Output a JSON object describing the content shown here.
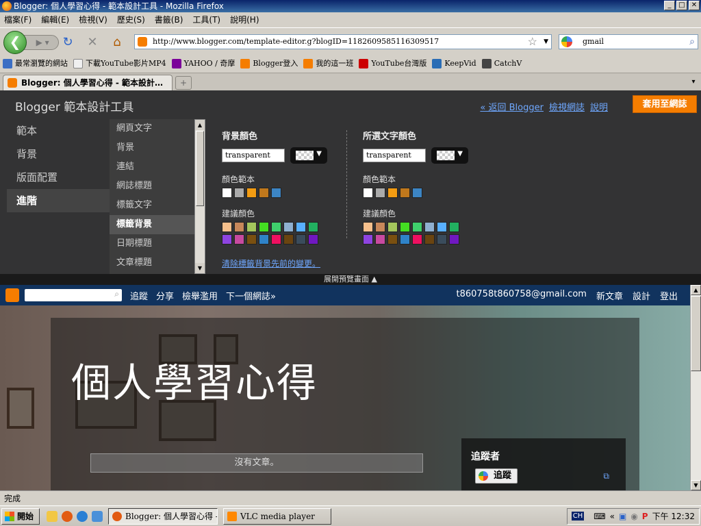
{
  "window": {
    "title": "Blogger: 個人學習心得 - 範本設計工具 - Mozilla Firefox"
  },
  "menu": [
    "檔案(F)",
    "編輯(E)",
    "檢視(V)",
    "歷史(S)",
    "書籤(B)",
    "工具(T)",
    "說明(H)"
  ],
  "address": {
    "url": "http://www.blogger.com/template-editor.g?blogID=1182609585116309517"
  },
  "search": {
    "value": "gmail"
  },
  "bookmarks": [
    {
      "label": "最常瀏覽的網站",
      "color": "#3c6fc4"
    },
    {
      "label": "下載YouTube影片MP4",
      "color": "#f0f0f0"
    },
    {
      "label": "YAHOO / 奇摩",
      "color": "#7b0099"
    },
    {
      "label": "Blogger登入",
      "color": "#f57d00"
    },
    {
      "label": "我的這一班",
      "color": "#f57d00"
    },
    {
      "label": "YouTube台灣版",
      "color": "#cc0000"
    },
    {
      "label": "KeepVid",
      "color": "#2a6db5"
    },
    {
      "label": "CatchV",
      "color": "#444444"
    }
  ],
  "tab": {
    "label": "Blogger: 個人學習心得 - 範本設計…"
  },
  "designer": {
    "title": "Blogger 範本設計工具",
    "links": [
      "« 返回 Blogger",
      "檢視網誌",
      "說明"
    ],
    "apply_label": "套用至網誌",
    "nav": [
      "範本",
      "背景",
      "版面配置",
      "進階"
    ],
    "subnav": [
      "網頁文字",
      "背景",
      "連結",
      "網誌標題",
      "標籤文字",
      "標籤背景",
      "日期標題",
      "文章標題"
    ],
    "bg_panel": {
      "title": "背景顏色",
      "value": "transparent",
      "scheme_label": "顏色範本",
      "suggest_label": "建議顏色"
    },
    "text_panel": {
      "title": "所選文字顏色",
      "value": "transparent",
      "scheme_label": "顏色範本",
      "suggest_label": "建議顏色"
    },
    "scheme_colors": [
      "#ffffff",
      "#aaaaaa",
      "#f39c12",
      "#c0781c",
      "#3c85c4"
    ],
    "suggest_row1": [
      "#f6c08c",
      "#c8885a",
      "#a4c65c",
      "#44dd22",
      "#3fcf6c",
      "#8fb0d0",
      "#58b0ff",
      "#22b060"
    ],
    "suggest_row2": [
      "#8e44e0",
      "#c84aa0",
      "#7a5010",
      "#2f83c8",
      "#ee1060",
      "#6a4410",
      "#3a4c5c",
      "#7018c0"
    ],
    "clear_link": "清除標籤背景先前的變更。"
  },
  "expand_label": "展開預覽畫面",
  "preview": {
    "nav": [
      "追蹤",
      "分享",
      "檢舉濫用",
      "下一個網誌»"
    ],
    "right": [
      "t860758t860758@gmail.com",
      "新文章",
      "設計",
      "登出"
    ],
    "blog_title": "個人學習心得",
    "no_posts": "沒有文章。",
    "follow_heading": "追蹤者",
    "follow_button": "追蹤"
  },
  "status": "完成",
  "taskbar": {
    "start": "開始",
    "tasks": [
      {
        "label": "Blogger: 個人學習心得 - ...",
        "color": "#e25b12"
      },
      {
        "label": "VLC media player",
        "color": "#ff8800"
      }
    ],
    "lang": "CH",
    "time": "下午 12:32"
  }
}
